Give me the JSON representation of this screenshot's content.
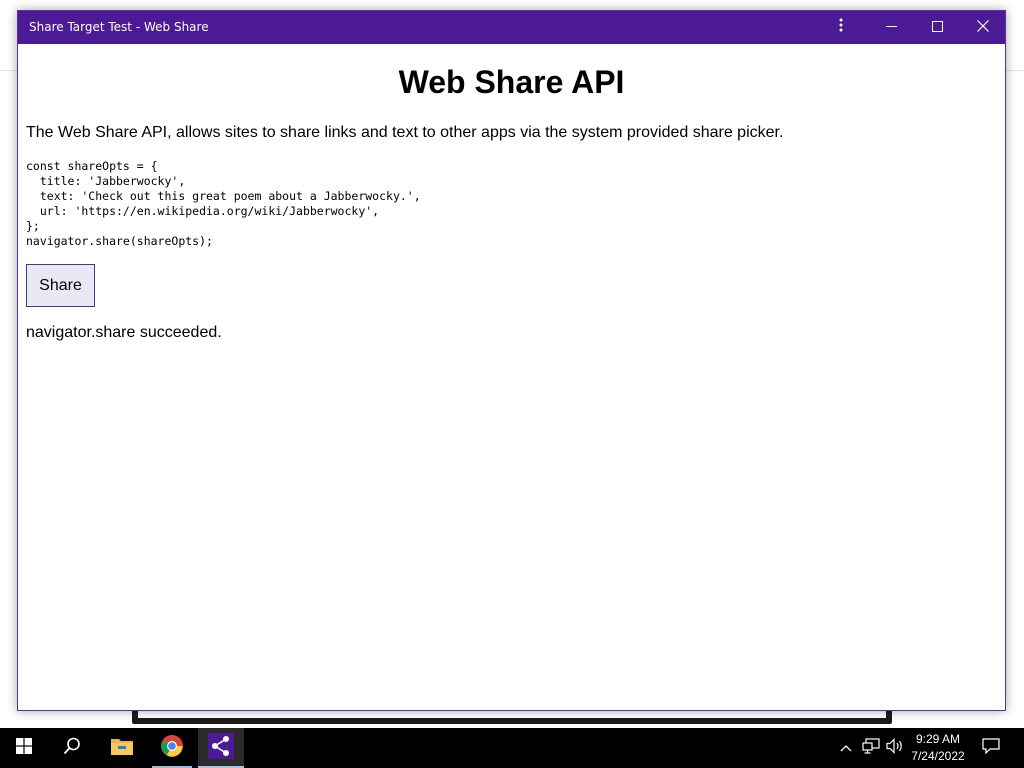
{
  "window": {
    "title": "Share Target Test - Web Share"
  },
  "page": {
    "heading": "Web Share API",
    "description": "The Web Share API, allows sites to share links and text to other apps via the system provided share picker.",
    "code": "const shareOpts = {\n  title: 'Jabberwocky',\n  text: 'Check out this great poem about a Jabberwocky.',\n  url: 'https://en.wikipedia.org/wiki/Jabberwocky',\n};\nnavigator.share(shareOpts);",
    "share_button_label": "Share",
    "status": "navigator.share succeeded."
  },
  "taskbar": {
    "apps": [
      {
        "icon": "windows-start-icon"
      },
      {
        "icon": "search-icon"
      },
      {
        "icon": "file-explorer-icon"
      },
      {
        "icon": "chrome-icon"
      },
      {
        "icon": "share-app-icon"
      }
    ],
    "clock": {
      "time": "9:29 AM",
      "date": "7/24/2022"
    }
  },
  "colors": {
    "titlebar": "#4d1a96",
    "button_bg": "#e9e9f6",
    "button_border": "#3c3c8c",
    "taskbar": "#000000"
  }
}
